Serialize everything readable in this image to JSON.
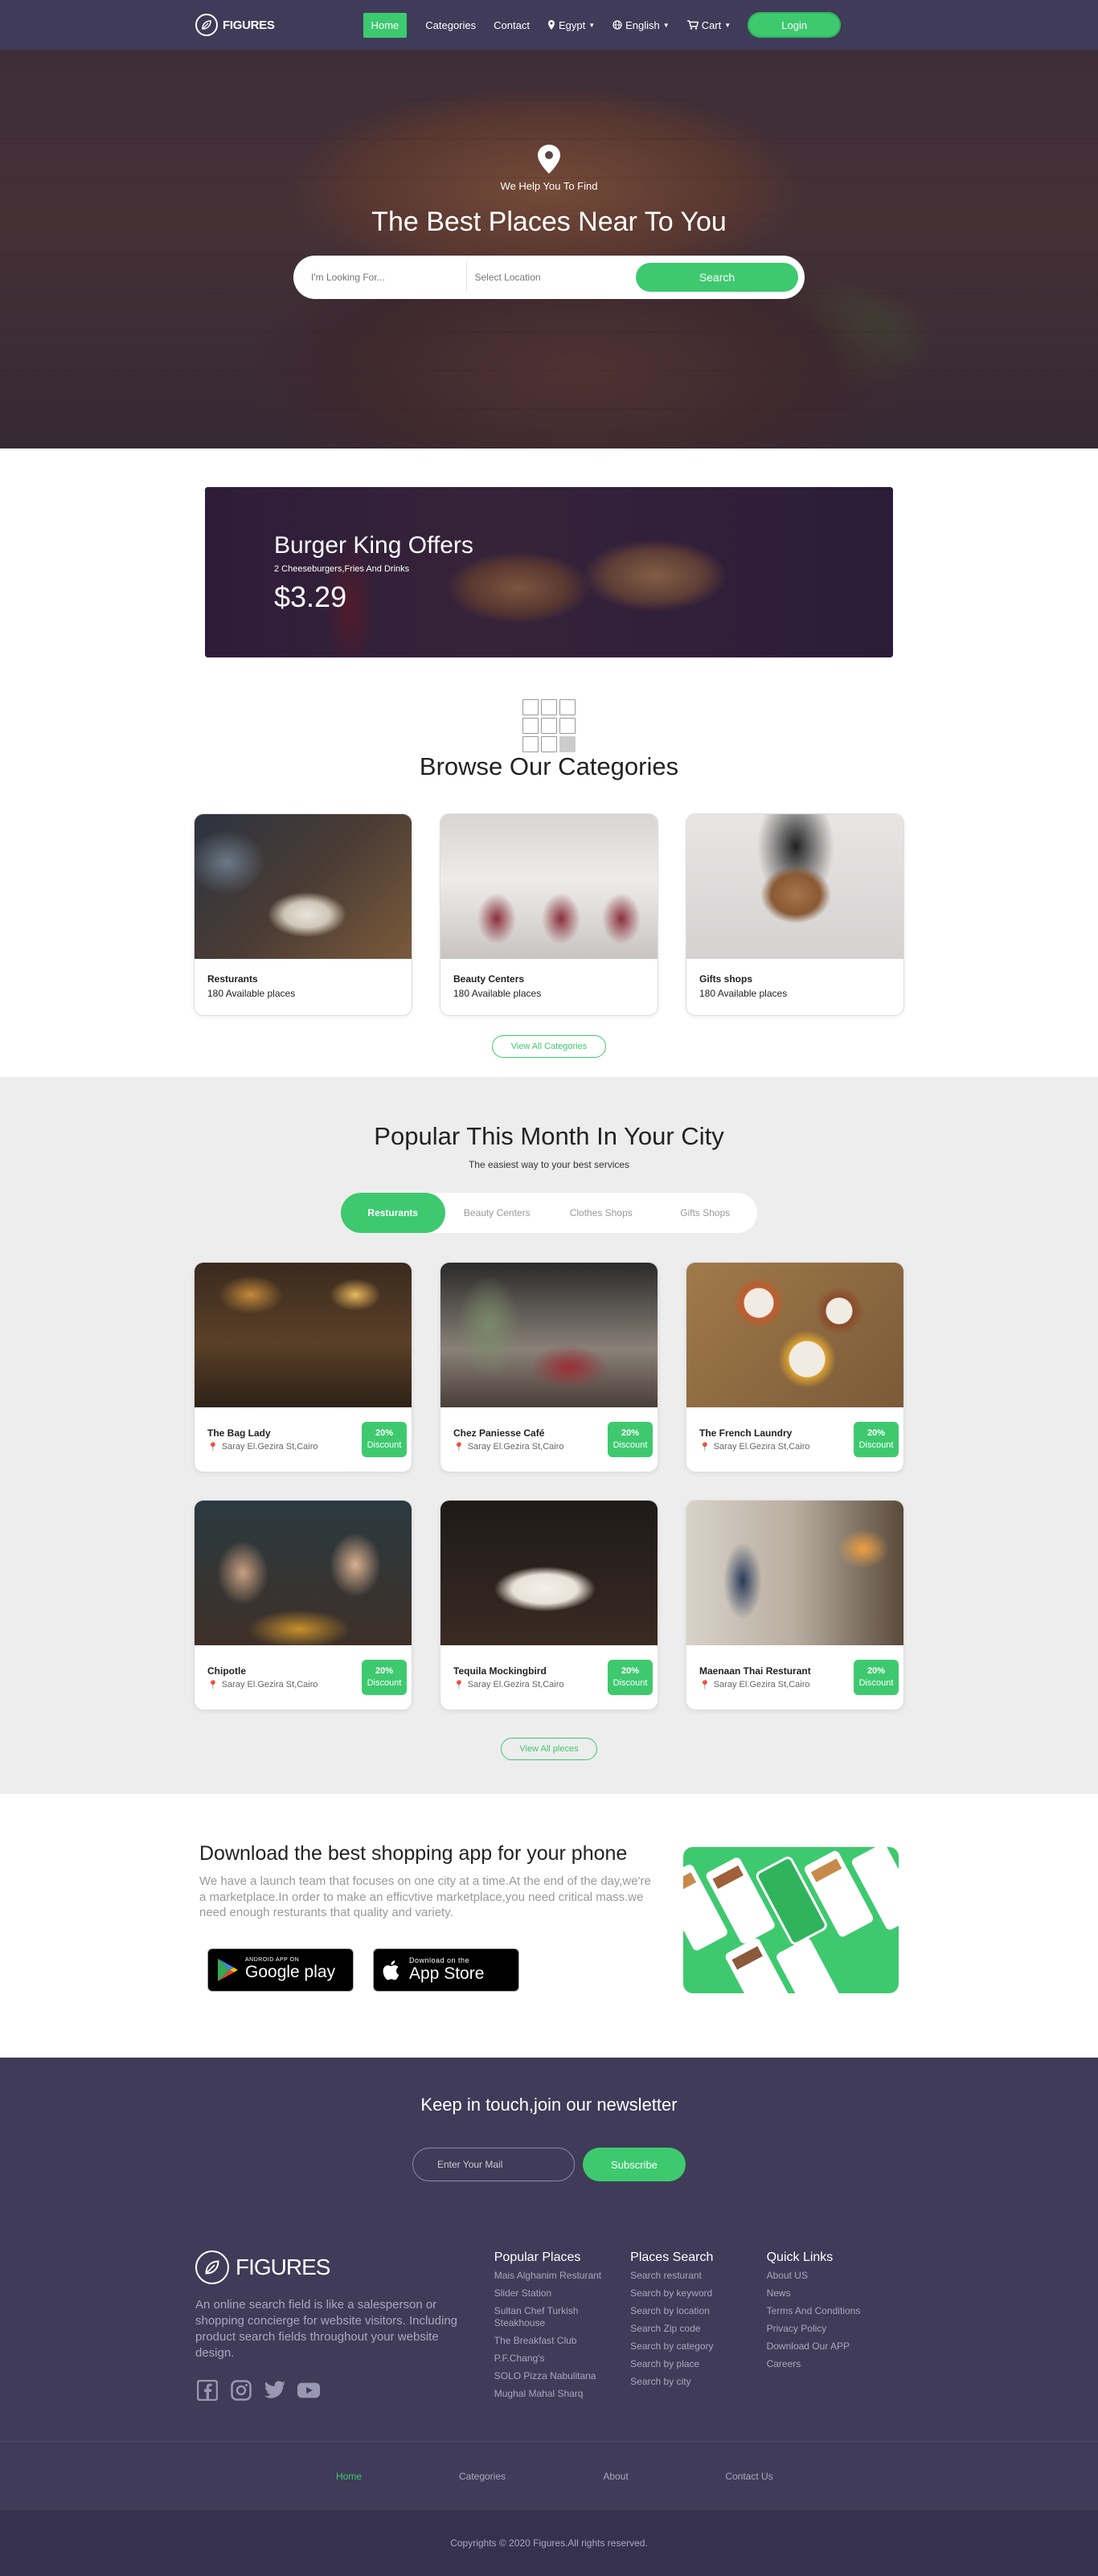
{
  "nav": {
    "logo": "FIGURES",
    "items": [
      "Home",
      "Categories",
      "Contact"
    ],
    "country": "Egypt",
    "language": "English",
    "cart": "Cart",
    "login": "Login"
  },
  "hero": {
    "small": "We Help You To Find",
    "title": "The Best Places Near To You",
    "search_placeholder": "I'm Looking For...",
    "location_placeholder": "Select Location",
    "search_button": "Search"
  },
  "offer": {
    "title": "Burger King Offers",
    "subtitle": "2 Cheeseburgers,Fries And Drinks",
    "price": "$3.29"
  },
  "categories": {
    "title": "Browse Our Categories",
    "items": [
      {
        "name": "Resturants",
        "count": "180 Available places"
      },
      {
        "name": "Beauty Centers",
        "count": "180 Available places"
      },
      {
        "name": "Gifts shops",
        "count": "180 Available places"
      }
    ],
    "view_all": "View All Categories"
  },
  "popular": {
    "title": "Popular This Month In Your City",
    "subtitle": "The easiest way to your best services",
    "tabs": [
      "Resturants",
      "Beauty Centers",
      "Clothes Shops",
      "Gifts Shops"
    ],
    "places": [
      {
        "name": "The Bag Lady",
        "address": "Saray El.Gezira St,Cairo",
        "discount": "20%",
        "discount_label": "Discount"
      },
      {
        "name": "Chez Paniesse Café",
        "address": "Saray El.Gezira St,Cairo",
        "discount": "20%",
        "discount_label": "Discount"
      },
      {
        "name": "The French Laundry",
        "address": "Saray El.Gezira St,Cairo",
        "discount": "20%",
        "discount_label": "Discount"
      },
      {
        "name": "Chipotle",
        "address": "Saray El.Gezira St,Cairo",
        "discount": "20%",
        "discount_label": "Discount"
      },
      {
        "name": "Tequila Mockingbird",
        "address": "Saray El.Gezira St,Cairo",
        "discount": "20%",
        "discount_label": "Discount"
      },
      {
        "name": "Maenaan Thai Resturant",
        "address": "Saray El.Gezira St,Cairo",
        "discount": "20%",
        "discount_label": "Discount"
      }
    ],
    "view_all": "View All pleces"
  },
  "app": {
    "title": "Download the best shopping app for your phone",
    "text": "We have a launch team that focuses on one city at a time.At the end of the day,we're a marketplace.In order to make an efficvtive marketplace,you need critical mass.we need enough resturants that quality and variety.",
    "google_small": "ANDROID APP ON",
    "google_big": "Google play",
    "apple_small": "Download on the",
    "apple_big": "App Store"
  },
  "newsletter": {
    "title": "Keep in touch,join our newsletter",
    "placeholder": "Enter Your Mail",
    "button": "Subscribe"
  },
  "footer": {
    "logo": "FIGURES",
    "description": "An online search field is like a salesperson or shopping concierge for website visitors. Including product search fields throughout your website design.",
    "col1": {
      "title": "Popular Places",
      "links": [
        "Mais Alghanim Resturant",
        "Slider Station",
        "Sultan Chef Turkish Steakhouse",
        "The Breakfast Club",
        "P.F.Chang's",
        "SOLO Pizza Nabulitana",
        "Mughal Mahal Sharq"
      ]
    },
    "col2": {
      "title": "Places Search",
      "links": [
        "Search resturant",
        "Search by keyword",
        "Search by location",
        "Search Zip code",
        "Search by category",
        "Search by place",
        "Search by city"
      ]
    },
    "col3": {
      "title": "Quick Links",
      "links": [
        "About US",
        "News",
        "Terms And Conditions",
        "Privacy Policy",
        "Download Our APP",
        "Careers"
      ]
    },
    "nav": [
      "Home",
      "Categories",
      "About",
      "Contact Us"
    ],
    "copyright": "Copyrights © 2020 Figures.All rights reserved."
  },
  "colors": {
    "primary": "#3ec96f",
    "dark": "#3f3b58"
  }
}
